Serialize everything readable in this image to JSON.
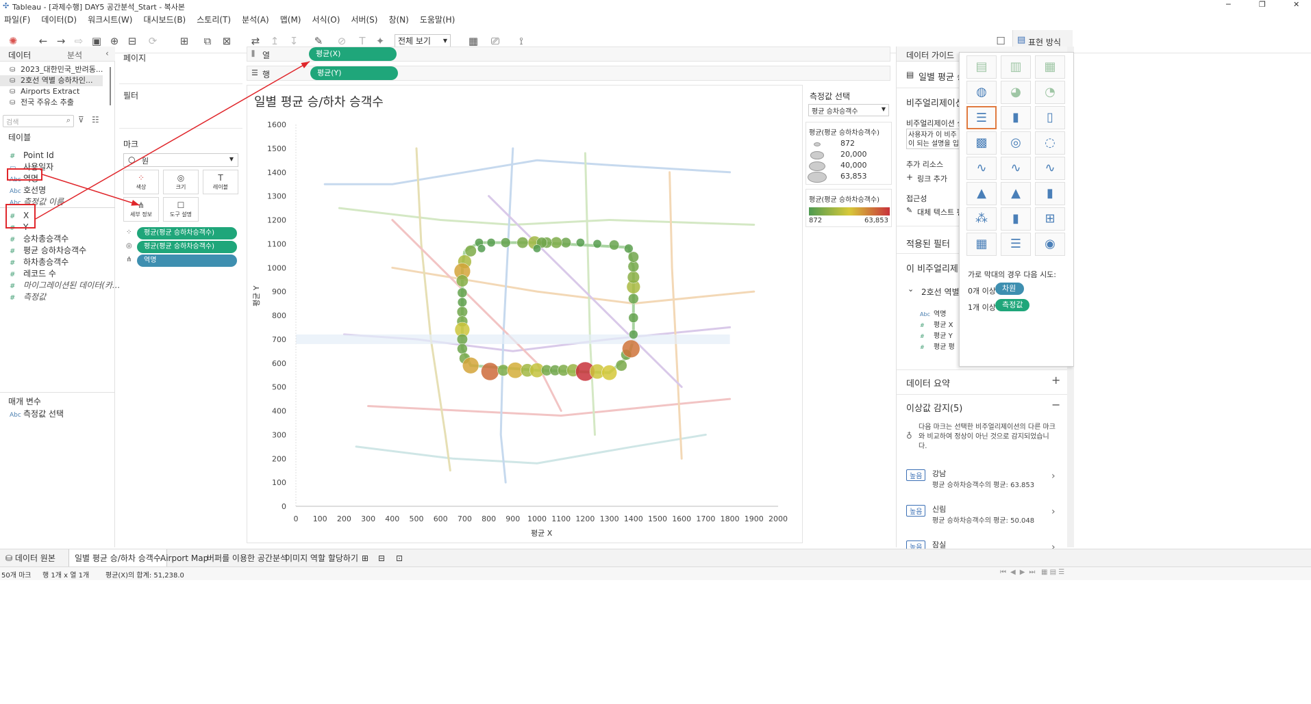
{
  "window": {
    "title": "Tableau - [과제수행] DAY5 공간분석_Start - 복사본"
  },
  "menu": [
    "파일(F)",
    "데이터(D)",
    "워크시트(W)",
    "대시보드(B)",
    "스토리(T)",
    "분석(A)",
    "맵(M)",
    "서식(O)",
    "서버(S)",
    "창(N)",
    "도움말(H)"
  ],
  "toolbar": {
    "fit_label": "전체 보기",
    "showme_label": "표현 방식"
  },
  "data_pane": {
    "tab_data": "데이터",
    "tab_analysis": "분석",
    "sources": [
      "2023_대한민국_반려동...",
      "2호선 역별 승하차인...",
      "Airports Extract",
      "전국 주유소 추출"
    ],
    "search_placeholder": "검색",
    "tables_label": "테이블",
    "fields": [
      {
        "type": "#",
        "name": "Point Id"
      },
      {
        "type": "date",
        "name": "사용일자"
      },
      {
        "type": "Abc",
        "name": "역명"
      },
      {
        "type": "Abc",
        "name": "호선명"
      },
      {
        "type": "Abc",
        "name": "측정값 이름"
      },
      {
        "type": "#",
        "name": "X"
      },
      {
        "type": "#",
        "name": "Y"
      },
      {
        "type": "#",
        "name": "승차총승객수"
      },
      {
        "type": "#",
        "name": "평균 승하차승객수"
      },
      {
        "type": "#",
        "name": "하차총승객수"
      },
      {
        "type": "#",
        "name": "레코드 수"
      },
      {
        "type": "#",
        "name": "마이그레이션된 데이터(카..."
      },
      {
        "type": "#",
        "name": "측정값"
      }
    ],
    "params_label": "매개 변수",
    "params": [
      {
        "type": "Abc",
        "name": "측정값 선택"
      }
    ]
  },
  "shelves": {
    "pages": "페이지",
    "filters": "필터",
    "marks": "마크",
    "mark_type": "원",
    "mark_buttons": [
      "색상",
      "크기",
      "레이블",
      "세부 정보",
      "도구 설명"
    ],
    "mark_pills": [
      "평균(평균 승하차승객수)",
      "평균(평균 승하차승객수)",
      "역명"
    ],
    "columns_label": "열",
    "rows_label": "행",
    "columns_pill": "평균(X)",
    "rows_pill": "평균(Y)"
  },
  "chart_data": {
    "type": "scatter",
    "title": "일별 평균 승/하차 승객수",
    "xlabel": "평균 X",
    "ylabel": "평균 Y",
    "xlim": [
      0,
      2000
    ],
    "ylim": [
      0,
      1600
    ],
    "x_ticks": [
      0,
      100,
      200,
      300,
      400,
      500,
      600,
      700,
      800,
      900,
      1000,
      1100,
      1200,
      1300,
      1400,
      1500,
      1600,
      1700,
      1800,
      1900,
      2000
    ],
    "y_ticks": [
      0,
      100,
      200,
      300,
      400,
      500,
      600,
      700,
      800,
      900,
      1000,
      1100,
      1200,
      1300,
      1400,
      1500,
      1600
    ],
    "points": [
      {
        "x": 725,
        "y": 1070,
        "v": 12000
      },
      {
        "x": 700,
        "y": 1025,
        "v": 22000
      },
      {
        "x": 690,
        "y": 985,
        "v": 40000
      },
      {
        "x": 690,
        "y": 945,
        "v": 14000
      },
      {
        "x": 690,
        "y": 895,
        "v": 6000
      },
      {
        "x": 690,
        "y": 855,
        "v": 5000
      },
      {
        "x": 690,
        "y": 815,
        "v": 9000
      },
      {
        "x": 690,
        "y": 775,
        "v": 10000
      },
      {
        "x": 690,
        "y": 740,
        "v": 30000
      },
      {
        "x": 690,
        "y": 700,
        "v": 9000
      },
      {
        "x": 690,
        "y": 660,
        "v": 8000
      },
      {
        "x": 700,
        "y": 620,
        "v": 10000
      },
      {
        "x": 725,
        "y": 590,
        "v": 40000
      },
      {
        "x": 805,
        "y": 565,
        "v": 52000
      },
      {
        "x": 860,
        "y": 570,
        "v": 12000
      },
      {
        "x": 910,
        "y": 570,
        "v": 38000
      },
      {
        "x": 960,
        "y": 570,
        "v": 20000
      },
      {
        "x": 1000,
        "y": 570,
        "v": 28000
      },
      {
        "x": 1040,
        "y": 570,
        "v": 10000
      },
      {
        "x": 1075,
        "y": 570,
        "v": 9000
      },
      {
        "x": 1110,
        "y": 570,
        "v": 12000
      },
      {
        "x": 1150,
        "y": 570,
        "v": 18000
      },
      {
        "x": 1200,
        "y": 565,
        "v": 63853
      },
      {
        "x": 1250,
        "y": 565,
        "v": 30000
      },
      {
        "x": 1300,
        "y": 560,
        "v": 32000
      },
      {
        "x": 1350,
        "y": 590,
        "v": 11000
      },
      {
        "x": 1370,
        "y": 635,
        "v": 9000
      },
      {
        "x": 1390,
        "y": 660,
        "v": 50048
      },
      {
        "x": 1400,
        "y": 720,
        "v": 4000
      },
      {
        "x": 1400,
        "y": 790,
        "v": 6000
      },
      {
        "x": 1400,
        "y": 870,
        "v": 8000
      },
      {
        "x": 1400,
        "y": 920,
        "v": 22000
      },
      {
        "x": 1400,
        "y": 960,
        "v": 15000
      },
      {
        "x": 1400,
        "y": 1005,
        "v": 10000
      },
      {
        "x": 1400,
        "y": 1045,
        "v": 9000
      },
      {
        "x": 1380,
        "y": 1080,
        "v": 4000
      },
      {
        "x": 1320,
        "y": 1095,
        "v": 7000
      },
      {
        "x": 1250,
        "y": 1100,
        "v": 3000
      },
      {
        "x": 1180,
        "y": 1105,
        "v": 3000
      },
      {
        "x": 1120,
        "y": 1105,
        "v": 8000
      },
      {
        "x": 1080,
        "y": 1105,
        "v": 12000
      },
      {
        "x": 1040,
        "y": 1105,
        "v": 10000
      },
      {
        "x": 990,
        "y": 1105,
        "v": 20000
      },
      {
        "x": 940,
        "y": 1105,
        "v": 11000
      },
      {
        "x": 870,
        "y": 1105,
        "v": 6000
      },
      {
        "x": 810,
        "y": 1105,
        "v": 3000
      },
      {
        "x": 760,
        "y": 1105,
        "v": 3000
      },
      {
        "x": 1020,
        "y": 1105,
        "v": 9000
      },
      {
        "x": 1000,
        "y": 1080,
        "v": 2000
      },
      {
        "x": 770,
        "y": 1080,
        "v": 2000
      }
    ]
  },
  "legends": {
    "param_title": "측정값 선택",
    "param_value": "평균 승차승객수",
    "size_title": "평균(평균 승하차승객수)",
    "size_values": [
      "872",
      "20,000",
      "40,000",
      "63,853"
    ],
    "color_title": "평균(평균 승하차승객수)",
    "color_min": "872",
    "color_max": "63,853",
    "color_low": "#4e9a51",
    "color_mid": "#d7c93a",
    "color_high": "#c8323b"
  },
  "data_guide": {
    "title": "데이터 가이드",
    "sheet": "일별 평균 승",
    "viz_desc_head": "비주얼리제이션",
    "viz_desc_label": "비주얼리제이션 설",
    "viz_desc_text": "사용자가 이 비주 이 되는 설명을 입",
    "resources_label": "추가 리소스",
    "add_link": "링크 추가",
    "access_label": "접근성",
    "alt_text": "대체 텍스트 편",
    "applied_filters": "적용된 필터",
    "this_viz": "이 비주얼리제이",
    "source_item": "2호선 역별",
    "source_fields": [
      "역명",
      "평균 X",
      "평균 Y",
      "평균 평"
    ],
    "data_summary": "데이터 요약",
    "outliers": "이상값 감지(5)",
    "outlier_desc": "다음 마크는 선택한 비주얼리제이션의 다른 마크와 비교하여 정상이 아닌 것으로 감지되었습니다.",
    "outlier_items": [
      {
        "badge": "높음",
        "name": "강남",
        "desc": "평균 승하차승객수의 평균: 63.853"
      },
      {
        "badge": "높음",
        "name": "신림",
        "desc": "평균 승하차승객수의 평균: 50.048"
      },
      {
        "badge": "높음",
        "name": "잠실",
        "desc": ""
      }
    ]
  },
  "showme": {
    "hint_title": "가로 막대의 경우 다음 시도:",
    "row1_label": "0개 이상",
    "row1_pill": "차원",
    "row2_label": "1개 이상",
    "row2_pill": "측정값"
  },
  "tabs": [
    "데이터 원본",
    "일별 평균 승/하차 승객수",
    "Airport Map",
    "버퍼를 이용한 공간분석",
    "이미지 역할 할당하기"
  ],
  "status": {
    "marks": "50개 마크",
    "rows": "행 1개 x 열 1개",
    "sum": "평균(X)의 합계: 51,238.0"
  }
}
